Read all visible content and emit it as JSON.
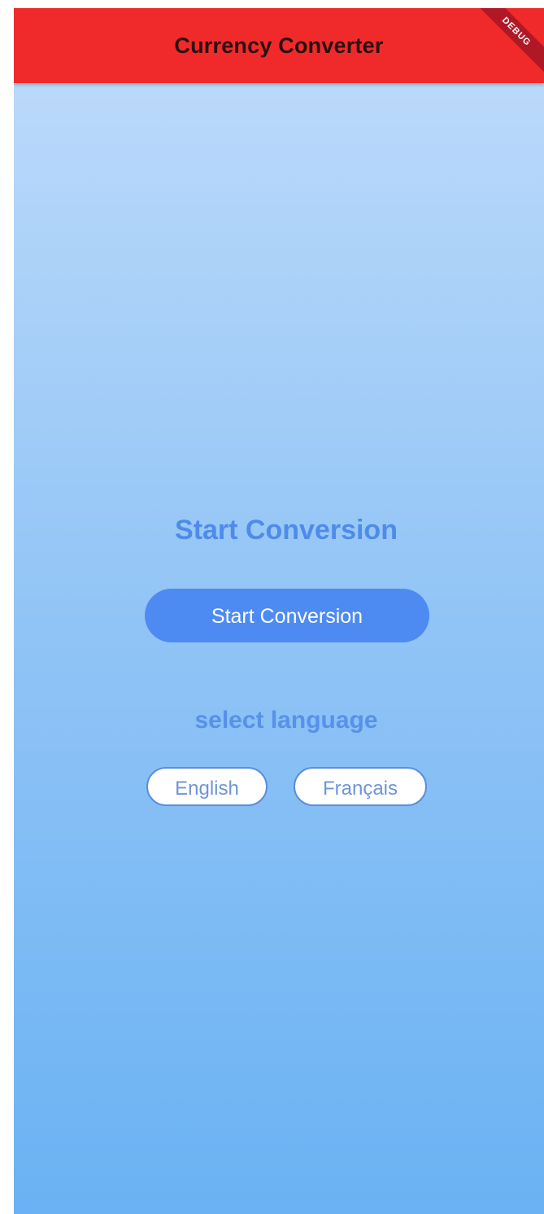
{
  "appbar": {
    "title": "Currency Converter",
    "debug_label": "DEBUG",
    "color": "#f02a2a"
  },
  "main": {
    "heading": "Start Conversion",
    "start_button_label": "Start Conversion",
    "select_language_label": "select language",
    "languages": [
      {
        "label": "English"
      },
      {
        "label": "Français"
      }
    ]
  },
  "colors": {
    "accent": "#4d8bf2",
    "background_top": "#bad9fa",
    "background_bottom": "#6ab2f3"
  }
}
